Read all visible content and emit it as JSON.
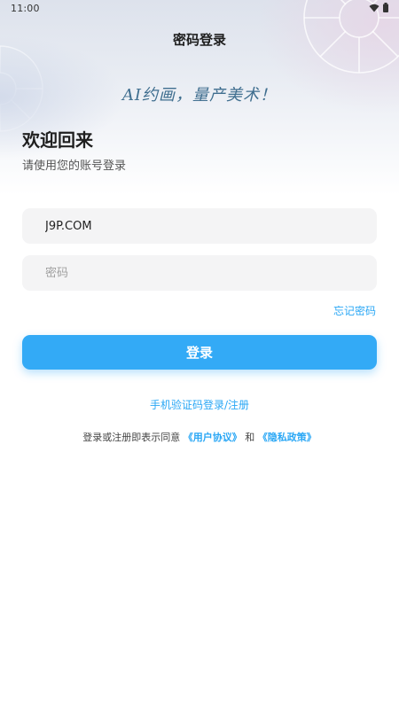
{
  "status_bar": {
    "time": "11:00",
    "icons": [
      "wifi-icon",
      "battery-icon"
    ]
  },
  "header": {
    "title": "密码登录"
  },
  "hero": {
    "slogan": "AI约画，量产美术！"
  },
  "welcome": {
    "title": "欢迎回来",
    "subtitle": "请使用您的账号登录"
  },
  "form": {
    "account_value": "J9P.COM",
    "account_placeholder": "",
    "password_value": "",
    "password_placeholder": "密码",
    "forgot_label": "忘记密码",
    "login_label": "登录"
  },
  "alt_login": {
    "label": "手机验证码登录/注册"
  },
  "agreement": {
    "prefix": "登录或注册即表示同意",
    "user_agreement": "《用户协议》",
    "joiner": "和",
    "privacy_policy": "《隐私政策》"
  },
  "colors": {
    "accent": "#33aaf6",
    "link": "#2aa7f5",
    "slogan": "#3f6e8f",
    "field_bg": "#f4f4f5"
  }
}
